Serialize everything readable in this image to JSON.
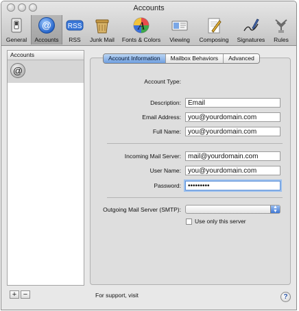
{
  "window": {
    "title": "Accounts"
  },
  "toolbar": {
    "items": [
      {
        "label": "General",
        "icon": "switch-icon"
      },
      {
        "label": "Accounts",
        "icon": "at-sign-icon",
        "selected": true
      },
      {
        "label": "RSS",
        "icon": "rss-icon"
      },
      {
        "label": "Junk Mail",
        "icon": "junk-mail-icon"
      },
      {
        "label": "Fonts & Colors",
        "icon": "fonts-colors-icon"
      },
      {
        "label": "Viewing",
        "icon": "viewing-icon"
      },
      {
        "label": "Composing",
        "icon": "composing-icon"
      },
      {
        "label": "Signatures",
        "icon": "signatures-icon"
      },
      {
        "label": "Rules",
        "icon": "rules-icon"
      }
    ],
    "rss_badge": "RSS",
    "at_glyph": "@"
  },
  "sidebar": {
    "header": "Accounts",
    "account_icon_glyph": "@",
    "add_label": "+",
    "remove_label": "−"
  },
  "tabs": [
    {
      "label": "Account Information",
      "active": true
    },
    {
      "label": "Mailbox Behaviors"
    },
    {
      "label": "Advanced"
    }
  ],
  "form": {
    "account_type_label": "Account Type:",
    "description_label": "Description:",
    "description_value": "Email",
    "email_label": "Email Address:",
    "email_value": "you@yourdomain.com",
    "fullname_label": "Full Name:",
    "fullname_value": "you@yourdomain.com",
    "incoming_label": "Incoming Mail Server:",
    "incoming_value": "mail@yourdomain.com",
    "username_label": "User Name:",
    "username_value": "you@yourdomain.com",
    "password_label": "Password:",
    "password_value": "•••••••••",
    "smtp_label": "Outgoing Mail Server (SMTP):",
    "smtp_value": "",
    "use_only_label": "Use only this server"
  },
  "footer": {
    "support_text": "For support, visit",
    "help_glyph": "?"
  },
  "colors": {
    "accent": "#6f9fe0",
    "focus": "#9cc0ee"
  }
}
